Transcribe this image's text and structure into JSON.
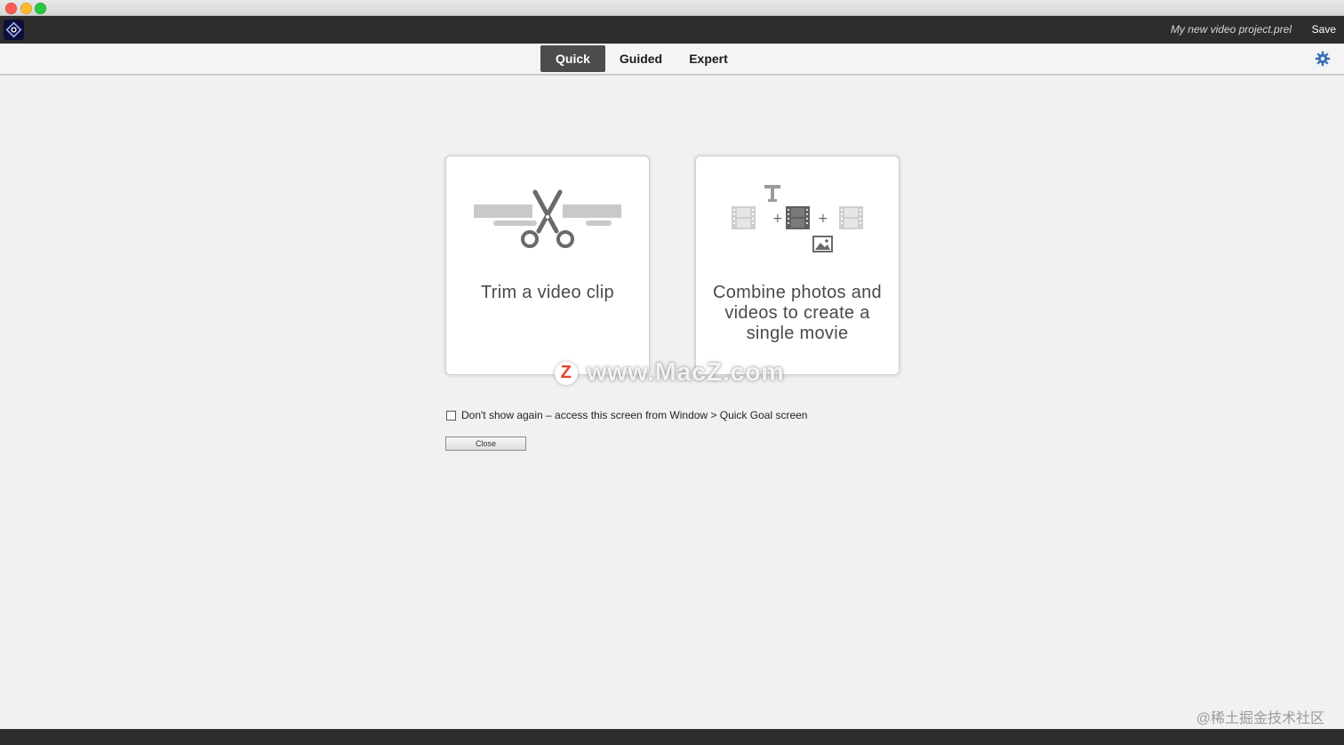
{
  "header": {
    "project_name": "My new video project.prel",
    "save_label": "Save"
  },
  "tabs": [
    {
      "label": "Quick",
      "active": true
    },
    {
      "label": "Guided",
      "active": false
    },
    {
      "label": "Expert",
      "active": false
    }
  ],
  "cards": [
    {
      "label": "Trim a video clip",
      "icon": "scissors-icon"
    },
    {
      "label": "Combine photos and videos to create a single movie",
      "icon": "combine-media-icon"
    }
  ],
  "options": {
    "dont_show_label": "Don't show again – access this screen from Window > Quick Goal screen",
    "dont_show_checked": false,
    "close_label": "Close"
  },
  "watermark": {
    "logo_letter": "Z",
    "text": "www.MacZ.com"
  },
  "credit": "@稀土掘金技术社区",
  "colors": {
    "active_tab_bg": "#4c4c4c",
    "app_bar": "#2d2d2d",
    "gear_accent": "#3b6fb6",
    "brand_logo": "#0e0e3a"
  }
}
